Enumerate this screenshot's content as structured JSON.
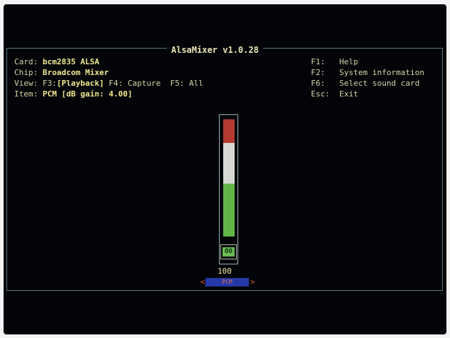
{
  "window": {
    "title": "AlsaMixer v1.0.28"
  },
  "info": {
    "card_label": "Card:",
    "card_value": "bcm2835 ALSA",
    "chip_label": "Chip:",
    "chip_value": "Broadcom Mixer",
    "view_label": "View:",
    "view_f3": "F3:",
    "view_f3_value": "[Playback]",
    "view_f4": "F4: Capture",
    "view_f5": "F5: All",
    "item_label": "Item:",
    "item_value": "PCM [dB gain: 4.00]"
  },
  "help": [
    {
      "key": "F1:",
      "label": "Help"
    },
    {
      "key": "F2:",
      "label": "System information"
    },
    {
      "key": "F6:",
      "label": "Select sound card"
    },
    {
      "key": "Esc:",
      "label": "Exit"
    }
  ],
  "control": {
    "level_fraction": 1.0,
    "volume_text": "100",
    "mute_label": "OO",
    "name": "PCM",
    "arrow_left": "<",
    "arrow_right": ">"
  },
  "colors": {
    "background": "#020407",
    "frame_border": "#5b7983",
    "bar_red": "#b33b2f",
    "bar_white": "#d7d7d3",
    "bar_green": "#64b547",
    "selected_bg": "#2538a6"
  }
}
